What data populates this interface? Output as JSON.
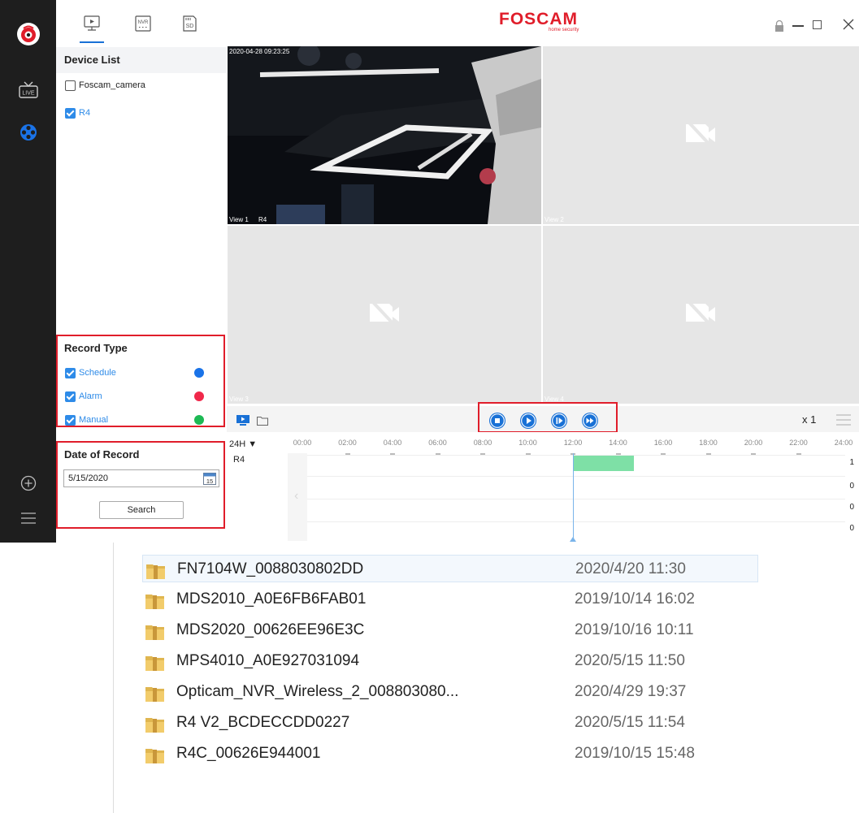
{
  "app": {
    "brand": "FOSCAM",
    "tagline": "home security",
    "brand_color": "#e01d2a",
    "accent_color": "#1971d6"
  },
  "rail": {
    "items": [
      {
        "icon": "logo-icon"
      },
      {
        "icon": "live-tv-icon",
        "label": "LIVE"
      },
      {
        "icon": "playback-reel-icon"
      },
      {
        "icon": "add-circle-icon"
      },
      {
        "icon": "menu-icon"
      }
    ]
  },
  "panel": {
    "tabs": [
      {
        "icon": "local-playback-icon"
      },
      {
        "icon": "nvr-icon",
        "label": "NVR"
      },
      {
        "icon": "sd-card-icon",
        "label": "SD"
      }
    ],
    "device_list_title": "Device List",
    "devices": [
      {
        "name": "Foscam_camera",
        "checked": false
      },
      {
        "name": "R4",
        "checked": true
      }
    ],
    "record_type_title": "Record Type",
    "record_types": [
      {
        "name": "Schedule",
        "checked": true,
        "color": "#1a73e8"
      },
      {
        "name": "Alarm",
        "checked": true,
        "color": "#f0284a"
      },
      {
        "name": "Manual",
        "checked": true,
        "color": "#1db954"
      }
    ],
    "date_title": "Date of Record",
    "date_value": "5/15/2020",
    "calendar_day": "15",
    "search_label": "Search"
  },
  "views": [
    {
      "label": "View 1",
      "device": "R4",
      "overlay": "2020-04-28 09:23:25"
    },
    {
      "label": "View 2"
    },
    {
      "label": "View 3"
    },
    {
      "label": "View 4"
    }
  ],
  "playback": {
    "speed": "x 1"
  },
  "timeline": {
    "range_label": "24H",
    "ticks": [
      "00:00",
      "02:00",
      "04:00",
      "06:00",
      "08:00",
      "10:00",
      "12:00",
      "14:00",
      "16:00",
      "18:00",
      "20:00",
      "22:00",
      "24:00"
    ],
    "row_label": "R4",
    "counts": [
      "1",
      "0",
      "0",
      "0"
    ],
    "segment_color": "#7ee0a6"
  },
  "files": [
    {
      "name": "FN7104W_0088030802DD",
      "date": "2020/4/20 11:30",
      "selected": true
    },
    {
      "name": "MDS2010_A0E6FB6FAB01",
      "date": "2019/10/14 16:02"
    },
    {
      "name": "MDS2020_00626EE96E3C",
      "date": "2019/10/16 10:11"
    },
    {
      "name": "MPS4010_A0E927031094",
      "date": "2020/5/15 11:50"
    },
    {
      "name": "Opticam_NVR_Wireless_2_008803080...",
      "date": "2020/4/29 19:37"
    },
    {
      "name": "R4 V2_BCDECCDD0227",
      "date": "2020/5/15 11:54"
    },
    {
      "name": "R4C_00626E944001",
      "date": "2019/10/15 15:48"
    }
  ]
}
